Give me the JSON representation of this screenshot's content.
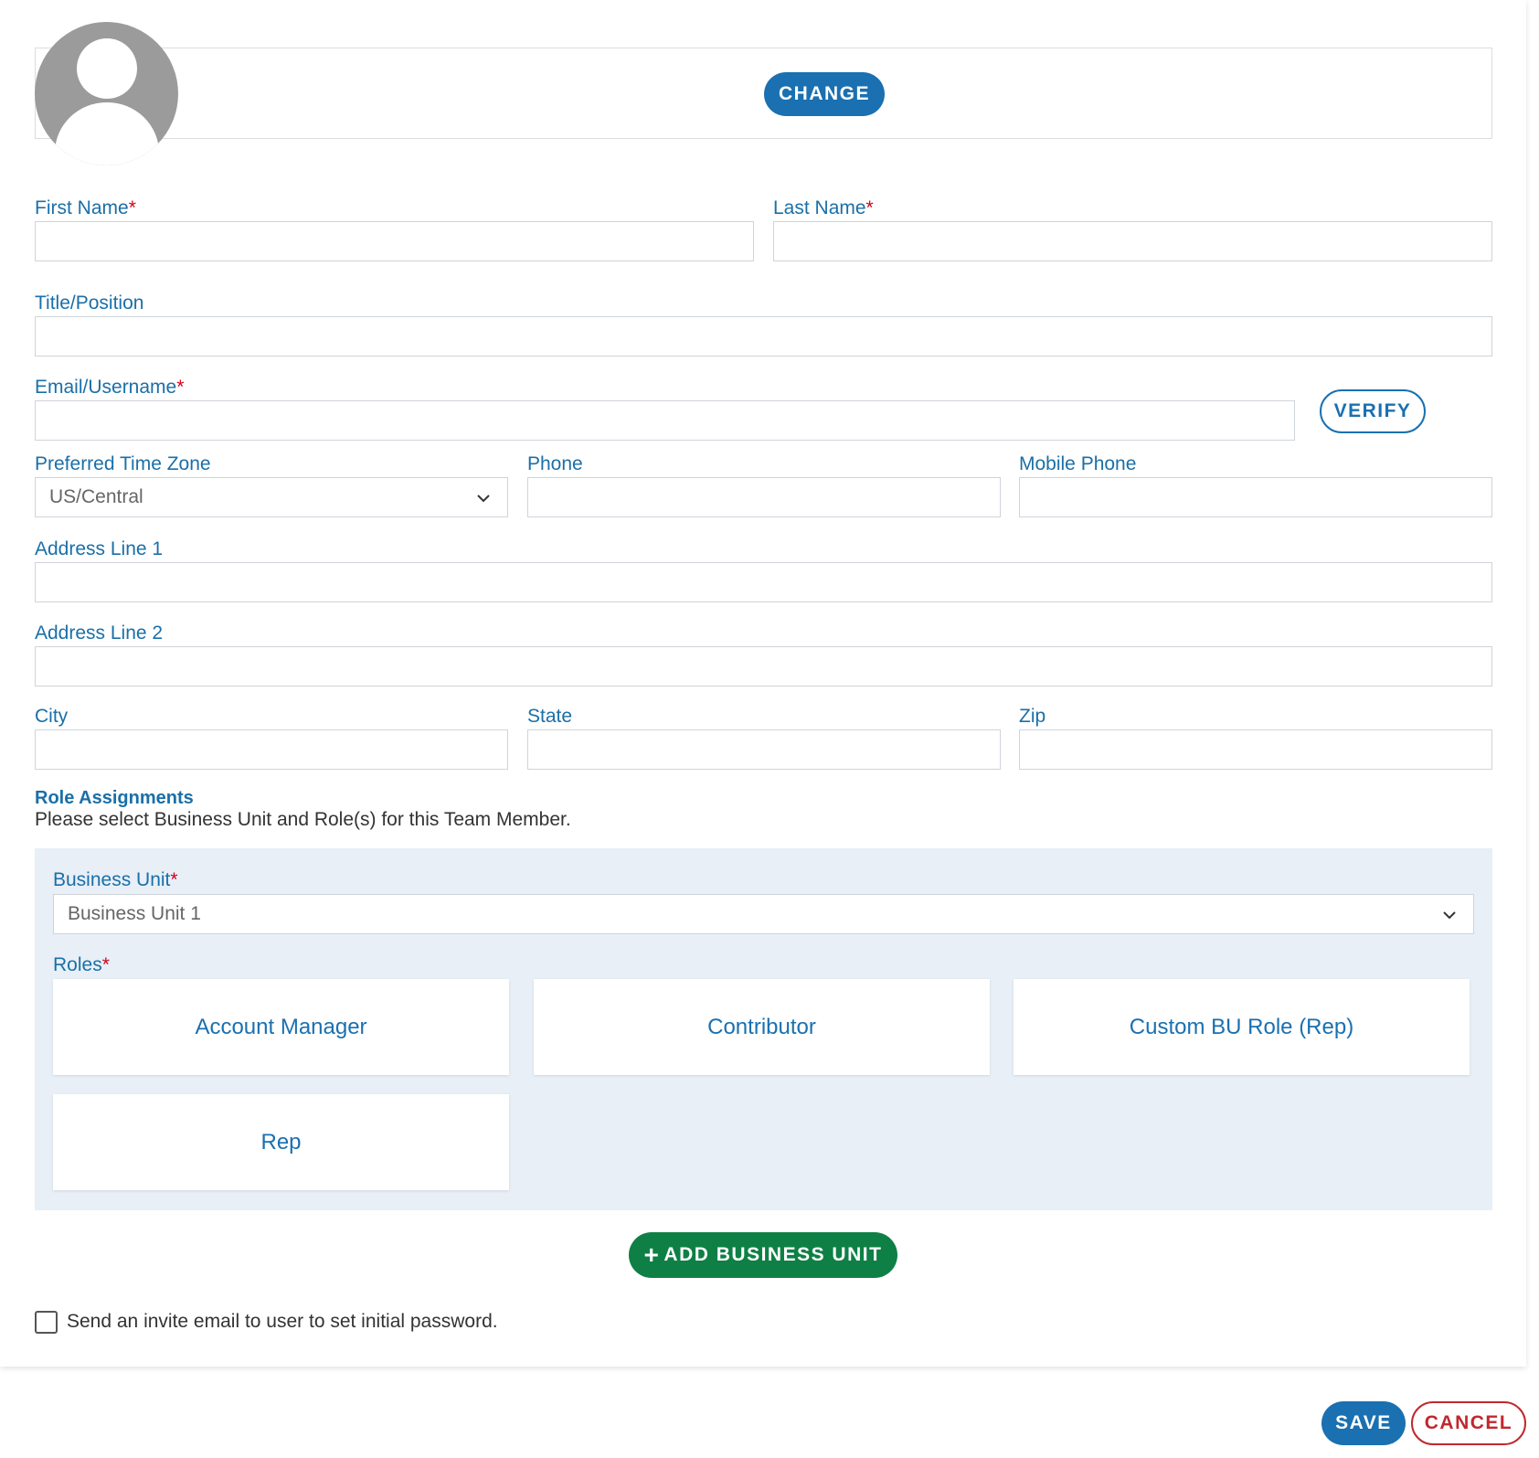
{
  "avatar": {
    "change_label": "CHANGE"
  },
  "fields": {
    "first_name": {
      "label": "First Name",
      "required_mark": "*",
      "value": ""
    },
    "last_name": {
      "label": "Last Name",
      "required_mark": "*",
      "value": ""
    },
    "title": {
      "label": "Title/Position",
      "value": ""
    },
    "email": {
      "label": "Email/Username",
      "required_mark": "*",
      "value": ""
    },
    "verify_label": "VERIFY",
    "timezone": {
      "label": "Preferred Time Zone",
      "value": "US/Central"
    },
    "phone": {
      "label": "Phone",
      "value": ""
    },
    "mobile": {
      "label": "Mobile Phone",
      "value": ""
    },
    "address1": {
      "label": "Address Line 1",
      "value": ""
    },
    "address2": {
      "label": "Address Line 2",
      "value": ""
    },
    "city": {
      "label": "City",
      "value": ""
    },
    "state": {
      "label": "State",
      "value": ""
    },
    "zip": {
      "label": "Zip",
      "value": ""
    }
  },
  "roles_section": {
    "title": "Role Assignments",
    "description": "Please select Business Unit and Role(s) for this Team Member.",
    "business_unit": {
      "label": "Business Unit",
      "required_mark": "*",
      "value": "Business Unit 1"
    },
    "roles_label": "Roles",
    "roles_required_mark": "*",
    "roles": [
      "Account Manager",
      "Contributor",
      "Custom BU Role (Rep)",
      "Rep"
    ]
  },
  "add_business_unit": {
    "icon": "plus-icon",
    "label": "ADD BUSINESS UNIT"
  },
  "invite": {
    "label": "Send an invite email to user to set initial password.",
    "checked": false
  },
  "footer": {
    "save_label": "SAVE",
    "cancel_label": "CANCEL"
  },
  "colors": {
    "primary_blue": "#1a70b0",
    "label_blue": "#1a6fa8",
    "green": "#0e8045",
    "red": "#c0282d",
    "required": "#d0021b",
    "panel_bg": "#e8eff7"
  }
}
